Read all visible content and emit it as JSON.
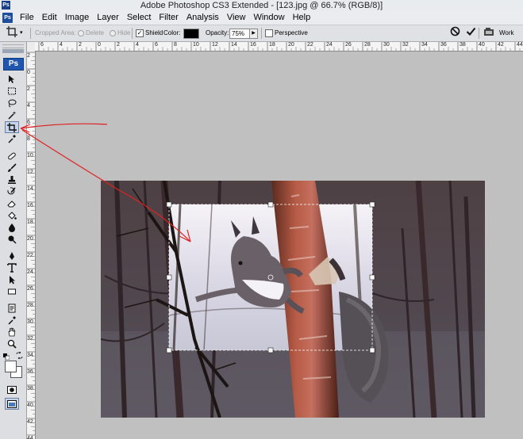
{
  "window": {
    "title": "Adobe Photoshop CS3 Extended - [123.jpg @ 66.7% (RGB/8)]",
    "logo_text": "Ps"
  },
  "menu": {
    "app_icon": "Ps",
    "items": [
      "File",
      "Edit",
      "Image",
      "Layer",
      "Select",
      "Filter",
      "Analysis",
      "View",
      "Window",
      "Help"
    ]
  },
  "options_bar": {
    "cropped_area_label": "Cropped Area:",
    "delete_label": "Delete",
    "hide_label": "Hide",
    "shield_label": "Shield",
    "color_label": "Color:",
    "shield_color": "#000000",
    "opacity_label": "Opacity:",
    "opacity_value": "75%",
    "perspective_label": "Perspective",
    "workspace_label": "Work"
  },
  "toolbox": {
    "badge": "Ps",
    "active_tool": "crop-tool"
  },
  "ruler_top_labels": [
    "6",
    "4",
    "2",
    "0",
    "2",
    "4",
    "6",
    "8",
    "10",
    "12",
    "14",
    "16",
    "18",
    "20",
    "22",
    "24",
    "26",
    "28",
    "30",
    "32",
    "34",
    "36",
    "38",
    "40",
    "42",
    "44"
  ],
  "ruler_left_labels": [
    "2",
    "0",
    "2",
    "4",
    "6",
    "8",
    "10",
    "12",
    "14",
    "16",
    "18",
    "20",
    "22",
    "24",
    "26",
    "28",
    "30",
    "32",
    "34",
    "36",
    "38",
    "40",
    "42",
    "44"
  ],
  "colors": {
    "annotation": "#e02020",
    "accent": "#1f56b0"
  }
}
